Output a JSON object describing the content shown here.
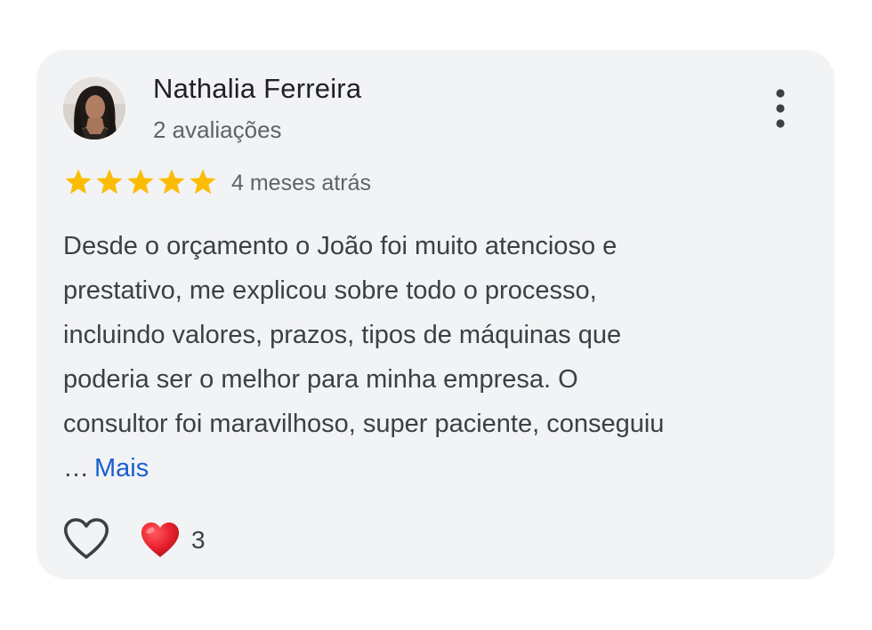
{
  "review": {
    "author_name": "Nathalia Ferreira",
    "author_reviews": "2 avaliações",
    "rating": 5,
    "rating_max": 5,
    "date": "4 meses atrás",
    "text_lines": [
      "Desde o orçamento o João foi muito atencioso e",
      "prestativo, me explicou sobre todo o processo,",
      "incluindo valores, prazos, tipos de máquinas que",
      "poderia ser o melhor para minha empresa. O",
      "consultor foi maravilhoso, super paciente, conseguiu"
    ],
    "ellipsis": "…",
    "more_label": "Mais",
    "reaction_count": "3"
  },
  "colors": {
    "card_background": "#f2f3f5",
    "star": "#fbbc04",
    "link": "#1a5fd0",
    "heart_reaction": "#e8202e"
  },
  "icons": {
    "menu": "more-vert-icon",
    "like": "heart-outline-icon",
    "reaction": "red-heart-emoji-icon"
  }
}
